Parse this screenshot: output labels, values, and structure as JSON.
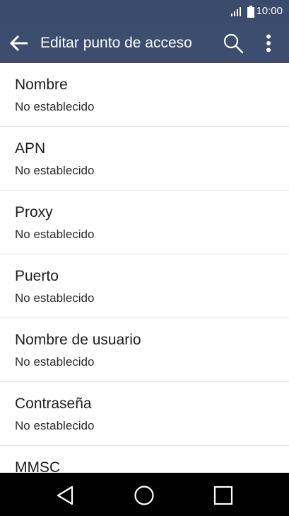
{
  "status_bar": {
    "time": "10:00",
    "signal_icon": "signal-icon",
    "battery_icon": "battery-icon"
  },
  "app_bar": {
    "title": "Editar punto de acceso",
    "back_icon": "arrow-back-icon",
    "search_icon": "search-icon",
    "more_icon": "more-vert-icon",
    "background_color": "#3c4d6e"
  },
  "settings": {
    "items": [
      {
        "title": "Nombre",
        "value": "No establecido"
      },
      {
        "title": "APN",
        "value": "No establecido"
      },
      {
        "title": "Proxy",
        "value": "No establecido"
      },
      {
        "title": "Puerto",
        "value": "No establecido"
      },
      {
        "title": "Nombre de usuario",
        "value": "No establecido"
      },
      {
        "title": "Contraseña",
        "value": "No establecido"
      },
      {
        "title": "MMSC",
        "value": ""
      }
    ]
  },
  "nav_bar": {
    "back_icon": "nav-back-triangle-icon",
    "home_icon": "nav-home-circle-icon",
    "recent_icon": "nav-recent-square-icon"
  }
}
